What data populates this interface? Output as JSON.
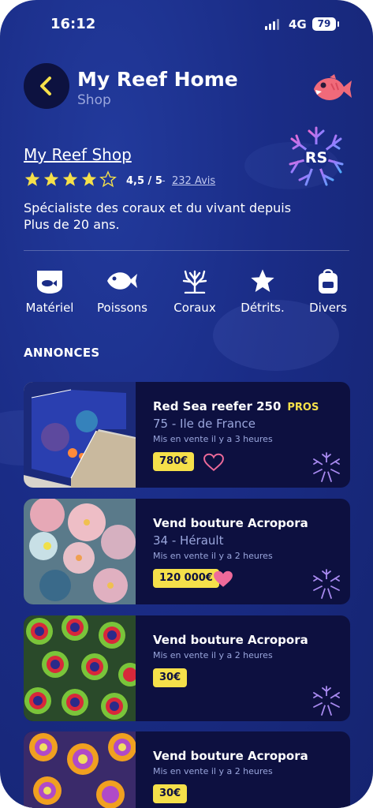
{
  "status": {
    "time": "16:12",
    "network": "4G",
    "battery": "79"
  },
  "header": {
    "title": "My Reef Home",
    "subtitle": "Shop"
  },
  "shop": {
    "name": "My Reef Shop",
    "stars_filled": 4,
    "stars_total": 5,
    "rating": "4,5 / 5",
    "separator": "-",
    "reviews": "232 Avis",
    "description": "Spécialiste des coraux et du vivant depuis Plus de 20 ans.",
    "logo_text": "RS"
  },
  "categories": [
    {
      "label": "Matériel",
      "icon": "aquarium-icon"
    },
    {
      "label": "Poissons",
      "icon": "fish-icon"
    },
    {
      "label": "Coraux",
      "icon": "coral-icon"
    },
    {
      "label": "Détrits.",
      "icon": "star-icon"
    },
    {
      "label": "Divers",
      "icon": "bag-icon"
    }
  ],
  "section_title": "ANNONCES",
  "listings": [
    {
      "title": "Red Sea reefer 250",
      "badge": "PROS",
      "location": "75 - Ile de France",
      "posted": "Mis en vente il y a 3 heures",
      "price": "780€",
      "favorite": false
    },
    {
      "title": "Vend bouture Acropora",
      "badge": "",
      "location": "34 - Hérault",
      "posted": "Mis en vente il y a 2 heures",
      "price": "120 000€",
      "favorite": true
    },
    {
      "title": "Vend bouture Acropora",
      "badge": "",
      "location": "",
      "posted": "Mis en vente il y a 2 heures",
      "price": "30€",
      "favorite": false
    },
    {
      "title": "Vend bouture Acropora",
      "badge": "",
      "location": "",
      "posted": "Mis en vente il y a 2 heures",
      "price": "30€",
      "favorite": false
    }
  ],
  "colors": {
    "background": "#1a2c86",
    "card": "#0d1040",
    "accent_yellow": "#f5e04a",
    "heart": "#ee6a9a",
    "star": "#f5e04a"
  }
}
